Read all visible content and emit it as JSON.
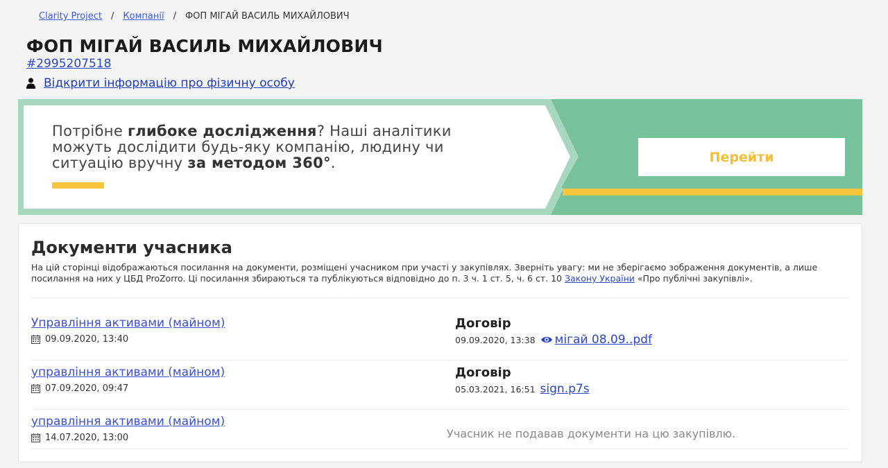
{
  "breadcrumb": {
    "items": [
      "Clarity Project",
      "Компанії"
    ],
    "current": "ФОП МІГАЙ ВАСИЛЬ МИХАЙЛОВИЧ",
    "separator": "/"
  },
  "page": {
    "title": "ФОП МІГАЙ ВАСИЛЬ МИХАЙЛОВИЧ",
    "company_id": "#2995207518",
    "person_link": "Відкрити інформацію про фізичну особу"
  },
  "promo": {
    "text_1": "Потрібне ",
    "text_bold_1": "глибоке дослідження",
    "text_2": "? Наші аналітики можуть дослідити будь-яку компанію, людину чи ситуацію вручну ",
    "text_bold_2": "за методом 360°",
    "text_3": ".",
    "button_label": "Перейти",
    "colors": {
      "background": "#78c29b",
      "accent": "#f7c53c"
    }
  },
  "documents": {
    "title": "Документи учасника",
    "description_1": "На цій сторінці відображаються посилання на документи, розміщені учасником при участі у закупівлях. Зверніть увагу: ми не зберігаємо зображення документів, а лише посилання на них у ЦБД ProZorro. Ці посилання збираються та публікуються відповідно до п. 3 ч. 1 ст. 5, ч. 6 ст. 10 ",
    "description_link": "Закону України",
    "description_2": " «Про публічні закупівлі».",
    "rows": [
      {
        "tender": "Управління активами (майном)",
        "date": "09.09.2020, 13:40",
        "doc_type": "Договір",
        "doc_date": "09.09.2020, 13:38",
        "file": "мігай 08.09..pdf"
      },
      {
        "tender": "управління активами (майном)",
        "date": "07.09.2020, 09:47",
        "doc_type": "Договір",
        "doc_date": "05.03.2021, 16:51",
        "file": "sign.p7s"
      },
      {
        "tender": "управління активами (майном)",
        "date": "14.07.2020, 13:00",
        "no_docs": "Учасник не подавав документи на цю закупівлю."
      }
    ]
  }
}
